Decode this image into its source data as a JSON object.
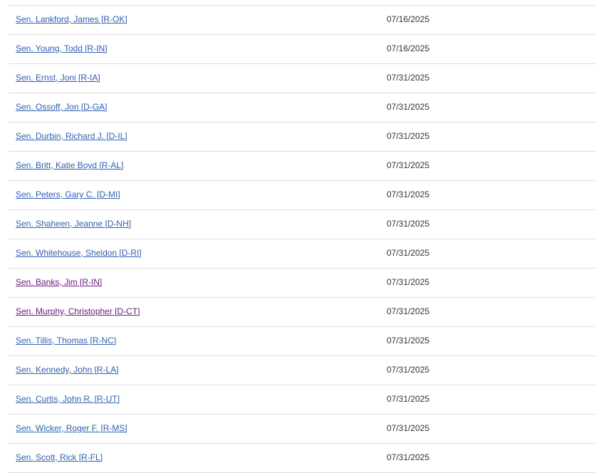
{
  "cosponsors": [
    {
      "name": "Sen. Lankford, James [R-OK]",
      "date": "07/16/2025",
      "visited": false
    },
    {
      "name": "Sen. Young, Todd [R-IN]",
      "date": "07/16/2025",
      "visited": false
    },
    {
      "name": "Sen. Ernst, Joni [R-IA]",
      "date": "07/31/2025",
      "visited": false
    },
    {
      "name": "Sen. Ossoff, Jon [D-GA]",
      "date": "07/31/2025",
      "visited": false
    },
    {
      "name": "Sen. Durbin, Richard J. [D-IL]",
      "date": "07/31/2025",
      "visited": false
    },
    {
      "name": "Sen. Britt, Katie Boyd [R-AL]",
      "date": "07/31/2025",
      "visited": false
    },
    {
      "name": "Sen. Peters, Gary C. [D-MI]",
      "date": "07/31/2025",
      "visited": false
    },
    {
      "name": "Sen. Shaheen, Jeanne [D-NH]",
      "date": "07/31/2025",
      "visited": false
    },
    {
      "name": "Sen. Whitehouse, Sheldon [D-RI]",
      "date": "07/31/2025",
      "visited": false
    },
    {
      "name": "Sen. Banks, Jim [R-IN]",
      "date": "07/31/2025",
      "visited": true
    },
    {
      "name": "Sen. Murphy, Christopher [D-CT]",
      "date": "07/31/2025",
      "visited": true
    },
    {
      "name": "Sen. Tillis, Thomas [R-NC]",
      "date": "07/31/2025",
      "visited": false
    },
    {
      "name": "Sen. Kennedy, John [R-LA]",
      "date": "07/31/2025",
      "visited": false
    },
    {
      "name": "Sen. Curtis, John R. [R-UT]",
      "date": "07/31/2025",
      "visited": false
    },
    {
      "name": "Sen. Wicker, Roger F. [R-MS]",
      "date": "07/31/2025",
      "visited": false
    },
    {
      "name": "Sen. Scott, Rick [R-FL]",
      "date": "07/31/2025",
      "visited": false
    }
  ],
  "colors": {
    "link": "#2f5faf",
    "visited_link": "#6a1a7a",
    "text": "#333333",
    "divider": "#dddddd"
  }
}
